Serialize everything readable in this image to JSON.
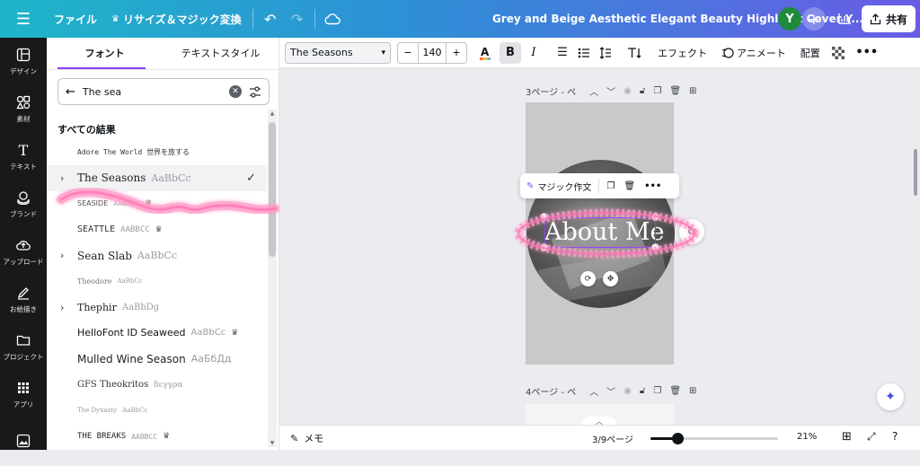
{
  "topbar": {
    "file": "ファイル",
    "resize": "リサイズ＆マジック変換",
    "title": "Grey and Beige Aesthetic Elegant Beauty  Highlight Cover Y...",
    "avatar_initial": "Y",
    "share": "共有"
  },
  "rail": [
    {
      "label": "デザイン",
      "icon": "layout-icon"
    },
    {
      "label": "素材",
      "icon": "elements-icon"
    },
    {
      "label": "テキスト",
      "icon": "text-icon"
    },
    {
      "label": "ブランド",
      "icon": "brand-icon"
    },
    {
      "label": "アップロード",
      "icon": "upload-icon"
    },
    {
      "label": "お絵描き",
      "icon": "draw-icon"
    },
    {
      "label": "プロジェクト",
      "icon": "folder-icon"
    },
    {
      "label": "アプリ",
      "icon": "apps-icon"
    },
    {
      "label": "",
      "icon": "photo-icon"
    }
  ],
  "panel": {
    "tabs": [
      "フォント",
      "テキストスタイル"
    ],
    "search_value": "The sea",
    "results_title": "すべての結果",
    "fonts": [
      {
        "name": "Adore The World 世界を旅する",
        "sample": "",
        "family": "DejaVu Sans Mono",
        "size": 8,
        "color": "#333",
        "chevron": false,
        "crown": false,
        "selected": false
      },
      {
        "name": "The Seasons",
        "sample": "AaBbCc",
        "family": "DejaVu Serif",
        "size": 12,
        "color": "#222",
        "chevron": true,
        "crown": false,
        "selected": true
      },
      {
        "name": "SEASIDE",
        "sample": "AABBCC",
        "family": "DejaVu Sans",
        "size": 8,
        "color": "#555",
        "chevron": false,
        "crown": true,
        "selected": false
      },
      {
        "name": "SEATTLE",
        "sample": "AABBCC",
        "family": "DejaVu Sans Mono",
        "size": 10,
        "color": "#333",
        "chevron": false,
        "crown": true,
        "selected": false
      },
      {
        "name": "Sean Slab",
        "sample": "AaBbCc",
        "family": "DejaVu Serif",
        "size": 12,
        "color": "#222",
        "chevron": true,
        "crown": false,
        "selected": false
      },
      {
        "name": "Theodore",
        "sample": "AaBbCc",
        "family": "DejaVu Serif",
        "size": 8,
        "color": "#777",
        "chevron": false,
        "crown": false,
        "selected": false
      },
      {
        "name": "Thephir",
        "sample": "AaBbDg",
        "family": "DejaVu Serif",
        "size": 11,
        "color": "#222",
        "chevron": true,
        "crown": false,
        "selected": false
      },
      {
        "name": "HelloFont ID Seaweed",
        "sample": "AaBbCc",
        "family": "DejaVu Sans",
        "size": 11,
        "color": "#111",
        "chevron": false,
        "crown": true,
        "selected": false
      },
      {
        "name": "Mulled Wine Season",
        "sample": "АаБбДд",
        "family": "DejaVu Sans",
        "size": 12,
        "color": "#222",
        "chevron": false,
        "crown": false,
        "selected": false
      },
      {
        "name": "GFS Theokritos",
        "sample": "δεγγρα",
        "family": "DejaVu Serif",
        "size": 10,
        "color": "#333",
        "chevron": false,
        "crown": false,
        "selected": false
      },
      {
        "name": "The Dynasty",
        "sample": "AaBbCc",
        "family": "DejaVu Serif",
        "size": 7,
        "color": "#999",
        "chevron": false,
        "crown": false,
        "selected": false
      },
      {
        "name": "THE BREAKS",
        "sample": "AABBCC",
        "family": "DejaVu Sans Mono",
        "size": 9,
        "color": "#222",
        "chevron": false,
        "crown": true,
        "selected": false
      }
    ]
  },
  "toolbar": {
    "font_name": "The Seasons",
    "font_size": "140",
    "effects": "エフェクト",
    "animate": "アニメート",
    "position": "配置"
  },
  "canvas": {
    "page3_label": "3ページ - ペ",
    "page4_label": "4ページ - ペ",
    "headline": "About Me",
    "magic_write": "マジック作文"
  },
  "bottombar": {
    "notes": "メモ",
    "page_indicator": "3/9ページ",
    "zoom": "21%",
    "zoom_fraction": 0.21
  },
  "accent_color": "#8b3dff"
}
